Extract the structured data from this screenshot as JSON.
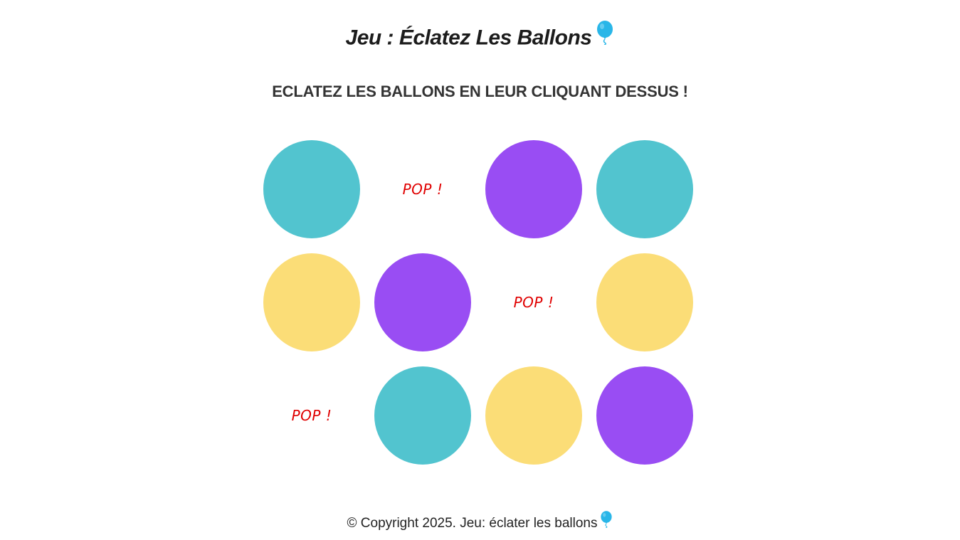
{
  "header": {
    "title": "Jeu : Éclatez Les Ballons",
    "title_icon": "balloon-icon"
  },
  "instructions": "ECLATEZ LES BALLONS EN LEUR CLIQUANT DESSUS !",
  "colors": {
    "teal": "#52C4CF",
    "purple": "#994DF3",
    "yellow": "#FBDD77",
    "pop": "#E00000",
    "balloon_icon": "#29B6E8"
  },
  "balloons": [
    {
      "state": "balloon",
      "color": "#52C4CF"
    },
    {
      "state": "popped",
      "text": "POP !"
    },
    {
      "state": "balloon",
      "color": "#994DF3"
    },
    {
      "state": "balloon",
      "color": "#52C4CF"
    },
    {
      "state": "balloon",
      "color": "#FBDD77"
    },
    {
      "state": "balloon",
      "color": "#994DF3"
    },
    {
      "state": "popped",
      "text": "POP !"
    },
    {
      "state": "balloon",
      "color": "#FBDD77"
    },
    {
      "state": "popped",
      "text": "POP !"
    },
    {
      "state": "balloon",
      "color": "#52C4CF"
    },
    {
      "state": "balloon",
      "color": "#FBDD77"
    },
    {
      "state": "balloon",
      "color": "#994DF3"
    }
  ],
  "footer": {
    "text": "© Copyright 2025. Jeu: éclater les ballons",
    "icon": "balloon-icon"
  }
}
